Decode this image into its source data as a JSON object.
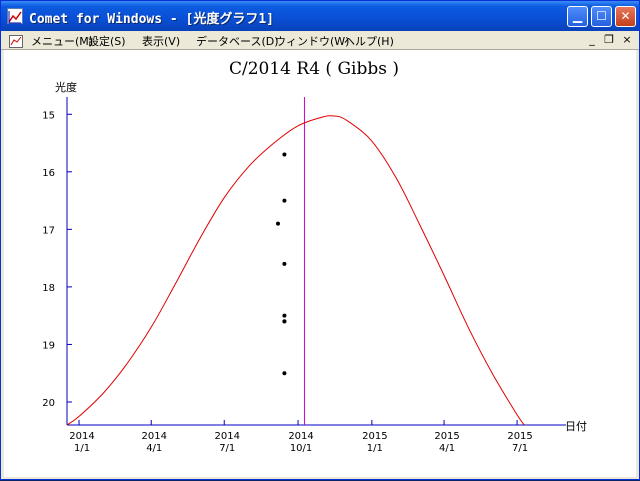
{
  "window": {
    "title": "Comet for Windows - [光度グラフ1]",
    "min_icon": "minimize-icon",
    "max_icon": "maximize-icon",
    "close_icon": "close-icon"
  },
  "menu": [
    {
      "label": "メニュー(M)"
    },
    {
      "label": "設定(S)"
    },
    {
      "label": "表示(V)"
    },
    {
      "label": "データベース(D)"
    },
    {
      "label": "ウィンドウ(W)"
    },
    {
      "label": "ヘルプ(H)"
    }
  ],
  "mdi_controls": {
    "minimize": "_",
    "restore": "❐",
    "close": "×"
  },
  "chart_data": {
    "type": "line",
    "title": "C/2014 R4 ( Gibbs )",
    "ylabel": "光度",
    "xlabel": "日付",
    "ylim": [
      20.4,
      14.7
    ],
    "y_inverted": true,
    "xlim": [
      "2013-12-17",
      "2015-08-31"
    ],
    "x_ticks": [
      {
        "date": "2014-01-01",
        "line1": "2014",
        "line2": "1/1"
      },
      {
        "date": "2014-04-01",
        "line1": "2014",
        "line2": "4/1"
      },
      {
        "date": "2014-07-01",
        "line1": "2014",
        "line2": "7/1"
      },
      {
        "date": "2014-10-01",
        "line1": "2014",
        "line2": "10/1"
      },
      {
        "date": "2015-01-01",
        "line1": "2015",
        "line2": "1/1"
      },
      {
        "date": "2015-04-01",
        "line1": "2015",
        "line2": "4/1"
      },
      {
        "date": "2015-07-01",
        "line1": "2015",
        "line2": "7/1"
      }
    ],
    "y_ticks": [
      15,
      16,
      17,
      18,
      19,
      20
    ],
    "series": [
      {
        "kind": "curve",
        "color": "#e00000",
        "points": [
          [
            "2013-12-17",
            20.4
          ],
          [
            "2014-01-01",
            20.25
          ],
          [
            "2014-01-31",
            19.85
          ],
          [
            "2014-03-01",
            19.35
          ],
          [
            "2014-04-01",
            18.7
          ],
          [
            "2014-05-01",
            17.95
          ],
          [
            "2014-06-01",
            17.15
          ],
          [
            "2014-07-01",
            16.45
          ],
          [
            "2014-08-01",
            15.9
          ],
          [
            "2014-09-01",
            15.5
          ],
          [
            "2014-10-01",
            15.2
          ],
          [
            "2014-10-31",
            15.05
          ],
          [
            "2014-11-15",
            15.03
          ],
          [
            "2014-11-30",
            15.1
          ],
          [
            "2014-12-31",
            15.45
          ],
          [
            "2015-01-31",
            16.1
          ],
          [
            "2015-03-01",
            16.9
          ],
          [
            "2015-04-01",
            17.8
          ],
          [
            "2015-05-01",
            18.7
          ],
          [
            "2015-05-31",
            19.5
          ],
          [
            "2015-06-30",
            20.2
          ],
          [
            "2015-07-10",
            20.4
          ]
        ]
      },
      {
        "kind": "observations",
        "color": "#000000",
        "points": [
          [
            "2014-09-14",
            15.7
          ],
          [
            "2014-09-14",
            16.5
          ],
          [
            "2014-09-06",
            16.9
          ],
          [
            "2014-09-14",
            17.6
          ],
          [
            "2014-09-14",
            18.5
          ],
          [
            "2014-09-14",
            18.6
          ],
          [
            "2014-09-14",
            18.6
          ],
          [
            "2014-09-14",
            19.5
          ]
        ]
      }
    ],
    "today_marker": {
      "date": "2014-10-09",
      "color": "#d000d0"
    },
    "axis_color": "#0000c0"
  }
}
